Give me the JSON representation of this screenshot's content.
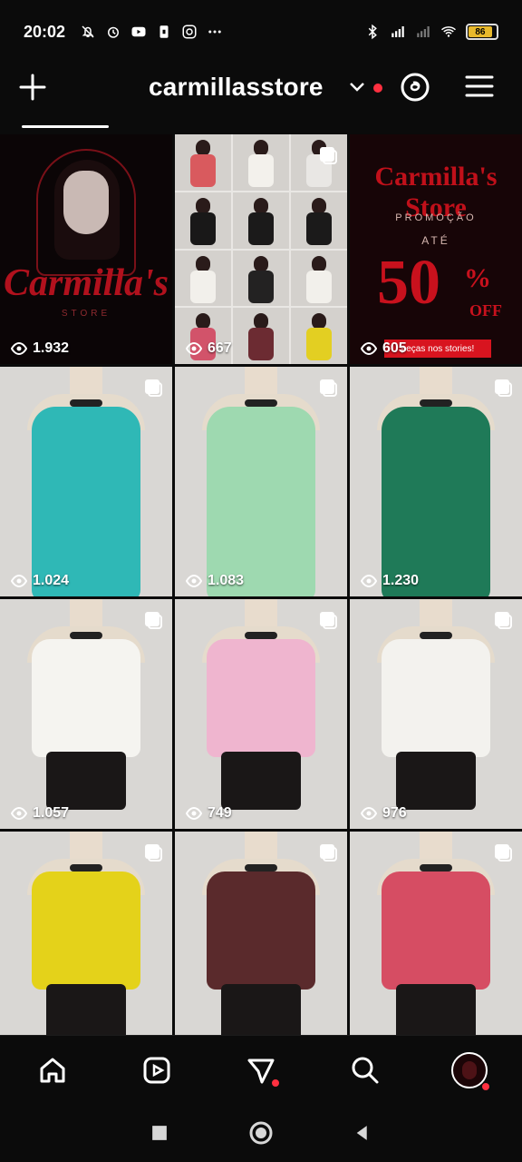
{
  "status_bar": {
    "time": "20:02",
    "left_icons": [
      "mute-bell-icon",
      "alarm-icon",
      "youtube-icon",
      "sim-card-icon",
      "instagram-icon",
      "more-dots-icon"
    ],
    "right_icons": [
      "bluetooth-icon",
      "signal-icon",
      "signal-weak-icon",
      "wifi-icon"
    ],
    "battery_level": 86
  },
  "header": {
    "username": "carmillasstore",
    "has_notification_dot": true
  },
  "posts": [
    {
      "type": "logo",
      "views": "1.932",
      "logo_title": "Carmilla's",
      "logo_sub": "STORE"
    },
    {
      "type": "collage",
      "views": "667"
    },
    {
      "type": "promo",
      "views": "605",
      "promo_title": "Carmilla's Store",
      "promo_sub": "PROMOÇÃO",
      "promo_ate": "ATÉ",
      "promo_big": "50",
      "promo_pct": "%",
      "promo_off": "OFF",
      "promo_banner": "peças nos stories!"
    },
    {
      "type": "dress",
      "views": "1.024",
      "color": "#2fb8b6",
      "multi": true
    },
    {
      "type": "dress",
      "views": "1.083",
      "color": "#9ed9b0",
      "multi": true
    },
    {
      "type": "dress",
      "views": "1.230",
      "color": "#1f7a58",
      "multi": true
    },
    {
      "type": "top-skirt",
      "views": "1.057",
      "color": "#f5f4f0",
      "multi": true
    },
    {
      "type": "top-skirt",
      "views": "749",
      "color": "#efb5cf",
      "multi": true
    },
    {
      "type": "top-skirt",
      "views": "976",
      "color": "#f3f2ee",
      "multi": true
    },
    {
      "type": "top-skirt",
      "views": "",
      "color": "#e4d21a",
      "multi": true
    },
    {
      "type": "top-skirt",
      "views": "",
      "color": "#5a2a2c",
      "multi": true
    },
    {
      "type": "top-skirt",
      "views": "",
      "color": "#d64d63",
      "multi": true
    }
  ],
  "bottom_nav": [
    "home-icon",
    "reels-icon",
    "send-icon",
    "search-icon",
    "profile-avatar"
  ],
  "system_nav": [
    "recent-apps-icon",
    "home-circle-icon",
    "back-icon"
  ]
}
